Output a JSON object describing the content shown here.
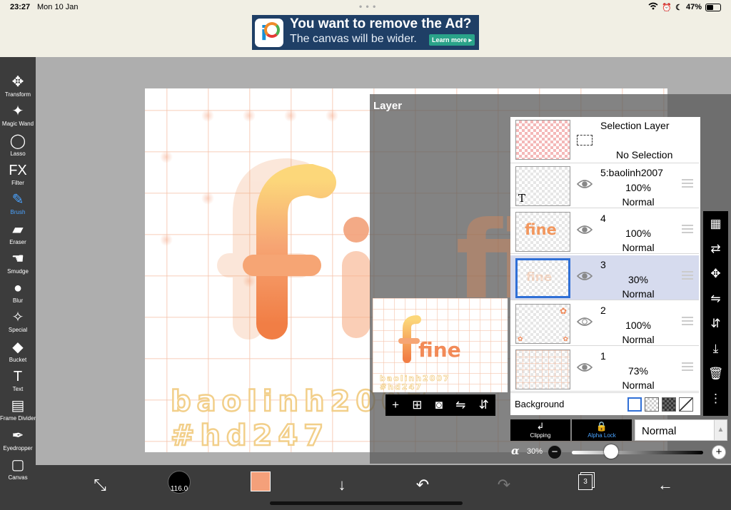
{
  "status_bar": {
    "time": "23:27",
    "date": "Mon 10 Jan",
    "battery": "47%",
    "battery_level": 0.47
  },
  "ad": {
    "headline": "You want to remove the Ad?",
    "subline": "The canvas will be wider.",
    "cta": "Learn more ▸",
    "brand_letter": "i"
  },
  "tools": [
    {
      "label": "Transform",
      "icon": "✥"
    },
    {
      "label": "Magic Wand",
      "icon": "✦"
    },
    {
      "label": "Lasso",
      "icon": "◯"
    },
    {
      "label": "Filter",
      "icon": "FX"
    },
    {
      "label": "Brush",
      "icon": "✎",
      "active": true
    },
    {
      "label": "Eraser",
      "icon": "▰"
    },
    {
      "label": "Smudge",
      "icon": "☚"
    },
    {
      "label": "Blur",
      "icon": "●"
    },
    {
      "label": "Special",
      "icon": "✧"
    },
    {
      "label": "Bucket",
      "icon": "◆"
    },
    {
      "label": "Text",
      "icon": "T"
    },
    {
      "label": "Frame Divider",
      "icon": "▤"
    },
    {
      "label": "Eyedropper",
      "icon": "✒"
    },
    {
      "label": "Canvas",
      "icon": "▢"
    }
  ],
  "artwork": {
    "word": "fine",
    "signature_line1": "baolinh2007",
    "signature_line2": "#hd247"
  },
  "layer_panel": {
    "title": "Layer",
    "selection_layer": {
      "name": "Selection Layer",
      "status": "No Selection"
    },
    "layers": [
      {
        "name": "5:baolinh2007",
        "opacity": "100%",
        "blend": "Normal",
        "kind": "text"
      },
      {
        "name": "4",
        "opacity": "100%",
        "blend": "Normal",
        "kind": "fine"
      },
      {
        "name": "3",
        "opacity": "30%",
        "blend": "Normal",
        "kind": "faint",
        "selected": true
      },
      {
        "name": "2",
        "opacity": "100%",
        "blend": "Normal",
        "kind": "flowers"
      },
      {
        "name": "1",
        "opacity": "73%",
        "blend": "Normal",
        "kind": "grid"
      }
    ],
    "text_layer_glyph": "T",
    "background_label": "Background",
    "clipping_label": "Clipping",
    "alpha_lock_label": "Alpha Lock",
    "blend_mode": "Normal",
    "alpha_symbol": "α",
    "alpha_value": "30%",
    "alpha_fraction": 0.3,
    "minus": "−",
    "plus": "+"
  },
  "bottom_bar": {
    "brush_size": "116.0",
    "layer_count": "3",
    "color": "#f4a07a"
  },
  "colors": {
    "accent": "#4aa3ff",
    "selected_border": "#2f6fd6",
    "toolbar": "#3c3c3c"
  }
}
